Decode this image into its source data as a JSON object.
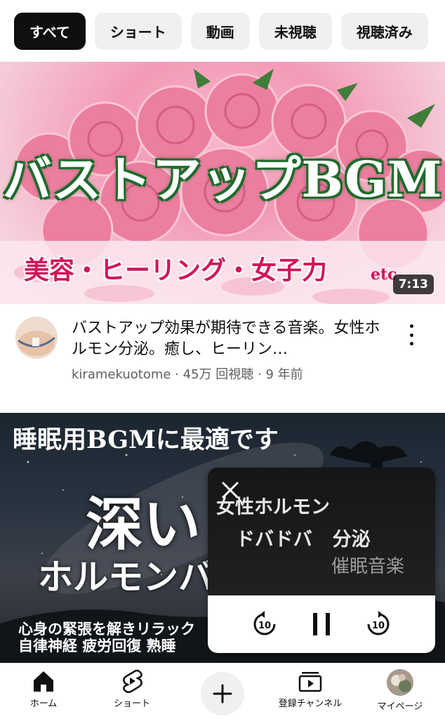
{
  "chips": [
    {
      "label": "すべて",
      "active": true
    },
    {
      "label": "ショート",
      "active": false
    },
    {
      "label": "動画",
      "active": false
    },
    {
      "label": "未視聴",
      "active": false
    },
    {
      "label": "視聴済み",
      "active": false
    }
  ],
  "video1": {
    "thumb_title": "バストアップBGM",
    "thumb_subtitle": "美容・ヒーリング・女子力",
    "thumb_etc": "etc",
    "duration": "7:13",
    "title": "バストアップ効果が期待できる音楽。女性ホルモン分泌。癒し、ヒーリン…",
    "channel": "kiramekuotome",
    "views": "45万 回視聴",
    "age": "9 年前"
  },
  "video2": {
    "thumb_top": "睡眠用BGMに最適です",
    "thumb_big": "深い",
    "thumb_mid": "ホルモンバ",
    "thumb_line1": "心身の緊張を解きリラック",
    "thumb_line2": "自律神経 疲労回復 熟睡"
  },
  "mini_player": {
    "line1": "女性ホルモン",
    "line2": "ドバドバ",
    "line2b": "分泌",
    "line3": "催眠音楽",
    "rewind_label": "10",
    "forward_label": "10"
  },
  "nav": {
    "home": "ホーム",
    "shorts": "ショート",
    "subscriptions": "登録チャンネル",
    "you": "マイページ"
  }
}
